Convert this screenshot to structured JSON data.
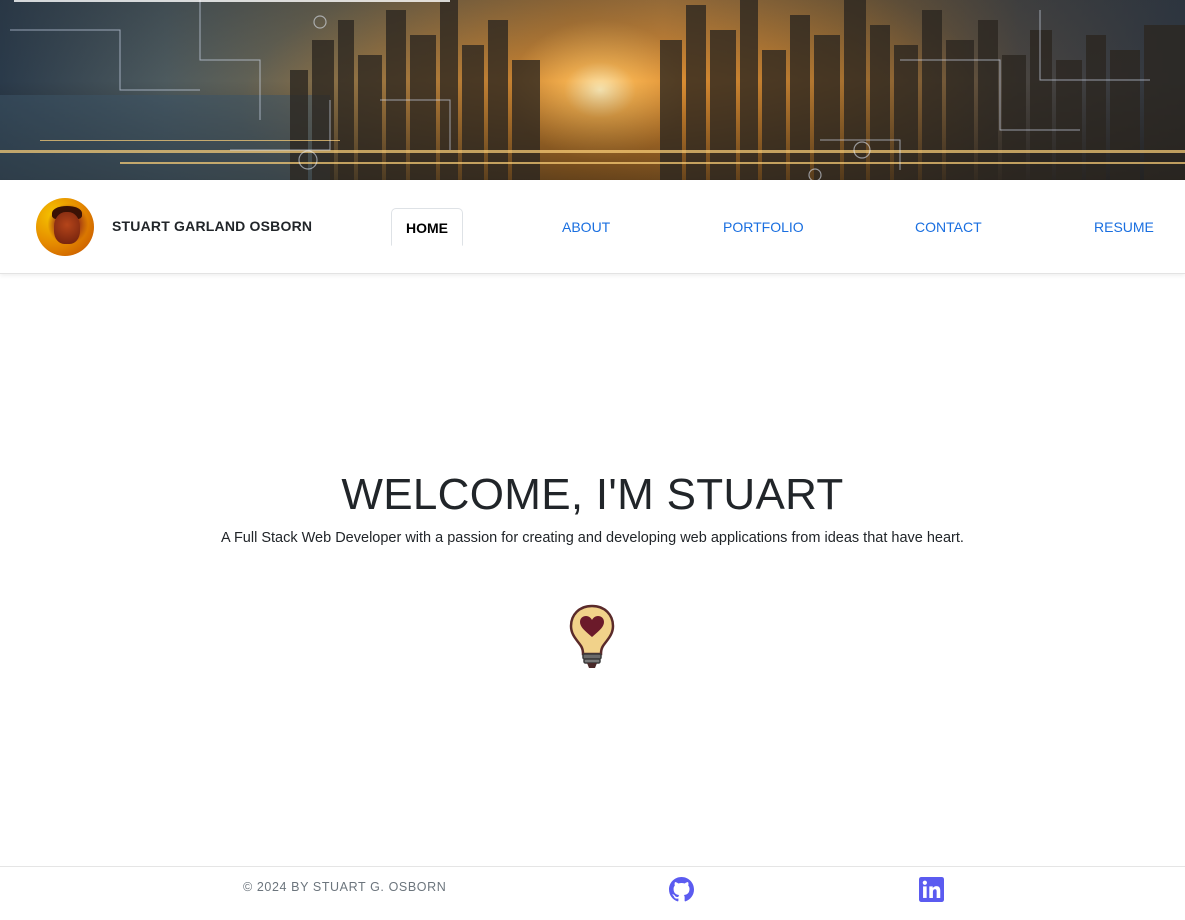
{
  "brand": {
    "name": "STUART GARLAND OSBORN"
  },
  "nav": {
    "items": [
      {
        "label": "HOME",
        "active": true
      },
      {
        "label": "ABOUT",
        "active": false
      },
      {
        "label": "PORTFOLIO",
        "active": false
      },
      {
        "label": "CONTACT",
        "active": false
      },
      {
        "label": "RESUME",
        "active": false
      }
    ]
  },
  "hero": {
    "title": "WELCOME, I'M STUART",
    "tagline": "A Full Stack Web Developer with a passion for creating and developing web applications from ideas that have heart.",
    "illustration_icon": "lightbulb-heart-icon"
  },
  "footer": {
    "copyright": "© 2024 BY STUART G. OSBORN",
    "links": [
      {
        "icon": "github-icon"
      },
      {
        "icon": "linkedin-icon"
      }
    ]
  },
  "colors": {
    "nav_link": "#1a6fe0",
    "footer_icon": "#5b5bf0",
    "text": "#212529",
    "muted": "#6c757d"
  }
}
